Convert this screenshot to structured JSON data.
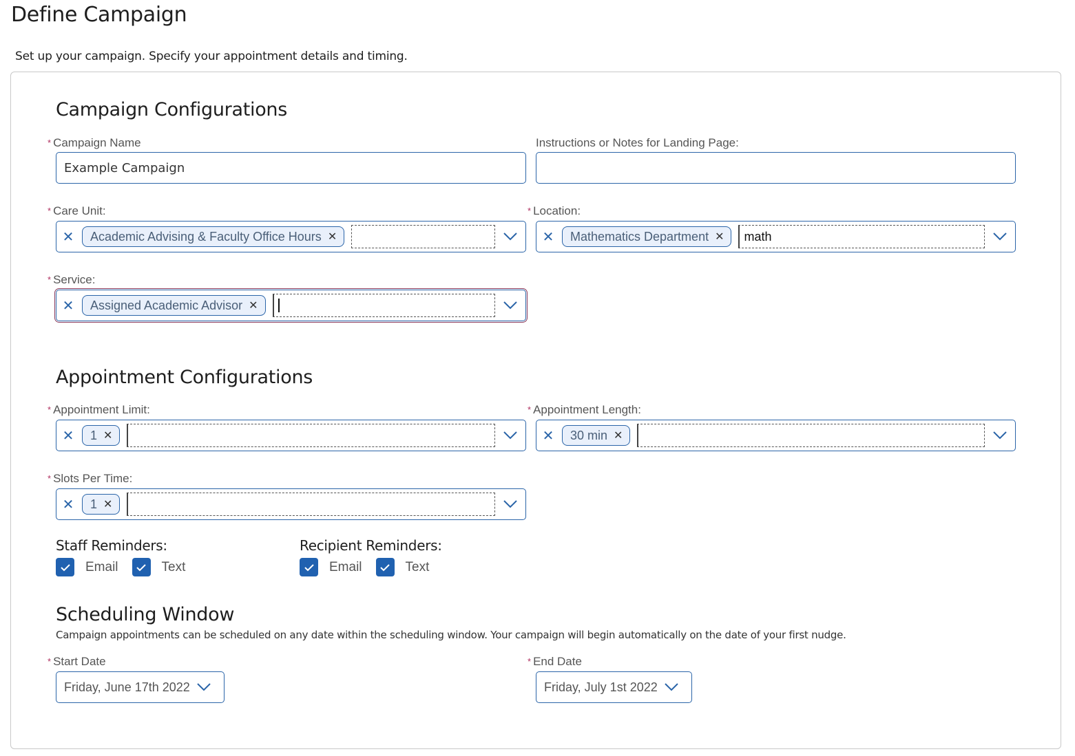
{
  "header": {
    "title": "Define Campaign",
    "subtitle": "Set up your campaign. Specify your appointment details and timing."
  },
  "campaign_config": {
    "title": "Campaign Configurations",
    "campaign_name": {
      "label": "Campaign Name",
      "required": true,
      "value": "Example Campaign"
    },
    "instructions": {
      "label": "Instructions or Notes for Landing Page:",
      "required": false,
      "value": ""
    },
    "care_unit": {
      "label": "Care Unit:",
      "required": true,
      "selected": [
        "Academic Advising & Faculty Office Hours"
      ],
      "search": ""
    },
    "location": {
      "label": "Location:",
      "required": true,
      "selected": [
        "Mathematics Department"
      ],
      "search": "math"
    },
    "service": {
      "label": "Service:",
      "required": true,
      "selected": [
        "Assigned Academic Advisor"
      ],
      "search": ""
    }
  },
  "appointment_config": {
    "title": "Appointment Configurations",
    "appointment_limit": {
      "label": "Appointment Limit:",
      "required": true,
      "selected": [
        "1"
      ],
      "search": ""
    },
    "appointment_length": {
      "label": "Appointment Length:",
      "required": true,
      "selected": [
        "30 min"
      ],
      "search": ""
    },
    "slots_per_time": {
      "label": "Slots Per Time:",
      "required": true,
      "selected": [
        "1"
      ],
      "search": ""
    },
    "staff_reminders": {
      "title": "Staff Reminders:",
      "options": [
        {
          "label": "Email",
          "checked": true
        },
        {
          "label": "Text",
          "checked": true
        }
      ]
    },
    "recipient_reminders": {
      "title": "Recipient Reminders:",
      "options": [
        {
          "label": "Email",
          "checked": true
        },
        {
          "label": "Text",
          "checked": true
        }
      ]
    }
  },
  "scheduling_window": {
    "title": "Scheduling Window",
    "description": "Campaign appointments can be scheduled on any date within the scheduling window. Your campaign will begin automatically on the date of your first nudge.",
    "start_date": {
      "label": "Start Date",
      "required": true,
      "value": "Friday, June 17th 2022"
    },
    "end_date": {
      "label": "End Date",
      "required": true,
      "value": "Friday, July 1st 2022"
    }
  },
  "icons": {
    "required": "*",
    "clear": "✕",
    "remove_chip": "✕"
  },
  "colors": {
    "accent": "#2a64a8",
    "checkbox": "#2061b0",
    "chip_bg": "#e9f0fb",
    "required": "#b03060"
  }
}
